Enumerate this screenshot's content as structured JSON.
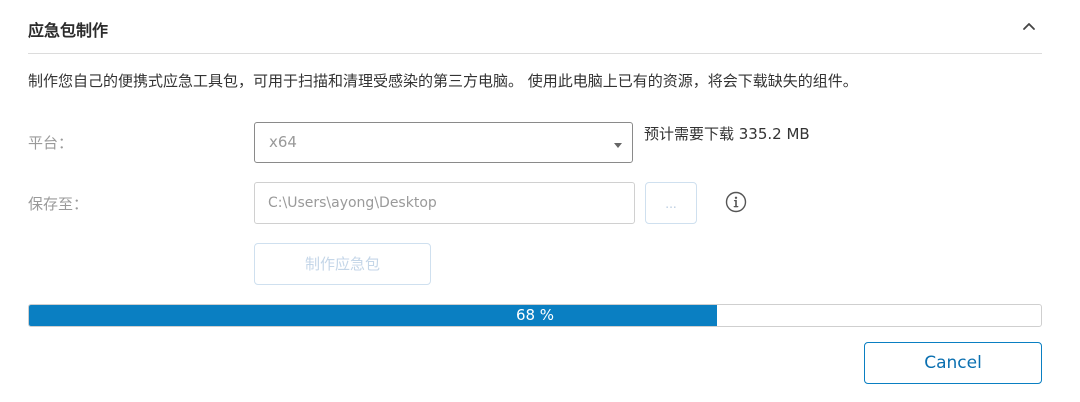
{
  "header": {
    "title": "应急包制作",
    "collapse_icon": "chevron-up-icon"
  },
  "description": "制作您自己的便携式应急工具包，可用于扫描和清理受感染的第三方电脑。 使用此电脑上已有的资源，将会下载缺失的组件。",
  "platform": {
    "label": "平台：",
    "selected": "x64",
    "download_note": "预计需要下载 335.2 MB"
  },
  "save_to": {
    "label": "保存至：",
    "path": "C:\\Users\\ayong\\Desktop",
    "browse_label": "...",
    "info_icon": "info-icon"
  },
  "make_button": "制作应急包",
  "progress": {
    "value": 68,
    "text": "68 %",
    "fill_color": "#0a7fc2"
  },
  "cancel_button": "Cancel"
}
